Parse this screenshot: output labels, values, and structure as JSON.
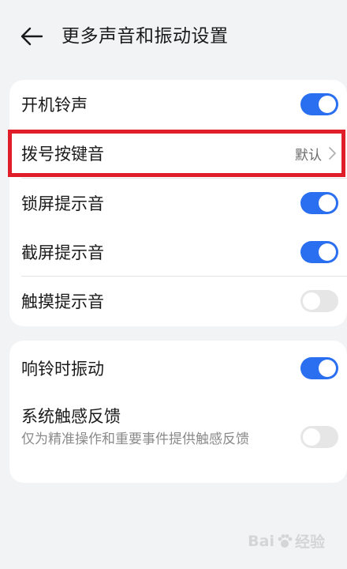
{
  "header": {
    "title": "更多声音和振动设置"
  },
  "group1": [
    {
      "label": "开机铃声",
      "type": "toggle",
      "on": true
    },
    {
      "label": "拨号按键音",
      "type": "link",
      "value": "默认"
    },
    {
      "label": "锁屏提示音",
      "type": "toggle",
      "on": true
    },
    {
      "label": "截屏提示音",
      "type": "toggle",
      "on": true
    },
    {
      "label": "触摸提示音",
      "type": "toggle",
      "on": false
    }
  ],
  "group2": [
    {
      "label": "响铃时振动",
      "type": "toggle",
      "on": true
    },
    {
      "label": "系统触感反馈",
      "description": "仅为精准操作和重要事件提供触感反馈",
      "type": "toggle",
      "on": false
    }
  ],
  "watermark": {
    "left": "Bai",
    "right": "经验"
  },
  "colors": {
    "accent": "#2a6ff0",
    "highlight": "#e01e2a",
    "background": "#f1f3f5"
  }
}
